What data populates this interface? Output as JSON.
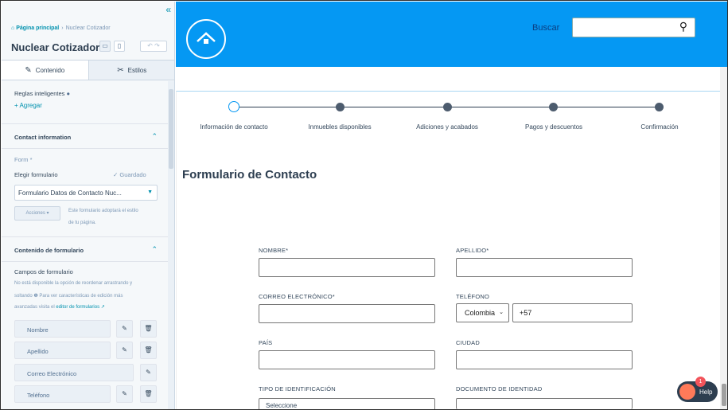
{
  "editor": {
    "breadcrumb": {
      "home": "Página principal",
      "current": "Nuclear Cotizador"
    },
    "title": "Nuclear Cotizador",
    "tabs": [
      {
        "label": "Contenido"
      },
      {
        "label": "Estilos"
      }
    ],
    "smart_rules": {
      "label": "Reglas inteligentes",
      "add": "+ Agregar"
    },
    "contact_section": {
      "label": "Contact information"
    },
    "form_label": "Form *",
    "choose_form": "Elegir formulario",
    "saved": "✓ Guardado",
    "form_select": "Formulario Datos de Contacto Nuc...",
    "actions_btn": "Acciones ▾",
    "actions_note_1": "Este formulario adoptará el estilo",
    "actions_note_2": "de tu página.",
    "form_content_section": {
      "label": "Contenido de formulario"
    },
    "fields_label": "Campos de formulario",
    "fields_note_1": "No está disponible la opción de reordenar arrastrando y",
    "fields_note_2": "soltando ❶ Para ver características de edición más",
    "fields_note_3": "avanzadas visita el",
    "fields_note_link": "editor de formularios ↗",
    "fields": [
      "Nombre",
      "Apellido",
      "Correo Electrónico",
      "Teléfono"
    ]
  },
  "site": {
    "search_label": "Buscar",
    "steps": [
      {
        "label": "Información de contacto",
        "active": true
      },
      {
        "label": "Inmuebles disponibles",
        "active": false
      },
      {
        "label": "Adiciones y acabados",
        "active": false
      },
      {
        "label": "Pagos y descuentos",
        "active": false
      },
      {
        "label": "Confirmación",
        "active": false
      }
    ],
    "form_title": "Formulario de Contacto",
    "labels": {
      "nombre": "NOMBRE*",
      "apellido": "APELLIDO*",
      "correo": "CORREO ELECTRÓNICO*",
      "telefono": "TELÉFONO",
      "pais": "PAÍS",
      "ciudad": "CIUDAD",
      "tipo_id": "TIPO DE IDENTIFICACIÓN",
      "documento": "DOCUMENTO DE IDENTIDAD"
    },
    "country_value": "Colombia",
    "phone_prefix": "+57",
    "id_select_value": "Seleccione",
    "help_label": "Help",
    "help_badge": "1"
  },
  "colors": {
    "hero": "#0598f3",
    "accent": "#0091ae"
  }
}
